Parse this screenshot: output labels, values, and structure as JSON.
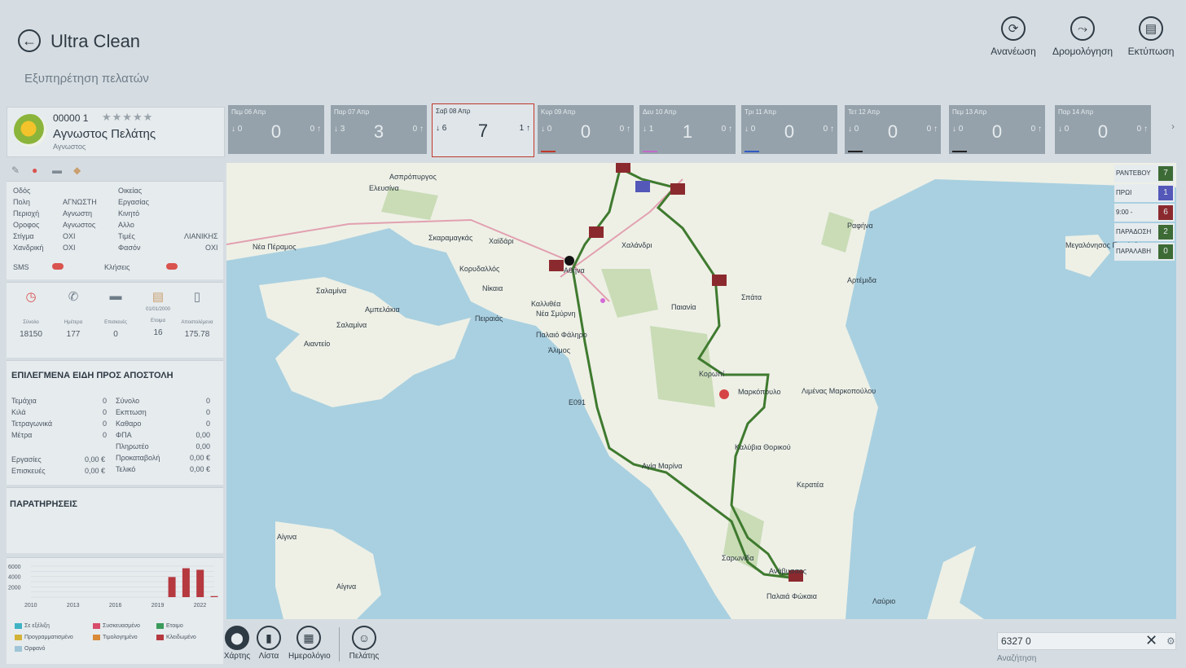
{
  "header": {
    "title": "Ultra Clean",
    "subtitle": "Εξυπηρέτηση πελατών",
    "buttons": [
      {
        "label": "Ανανέωση",
        "icon": "refresh-icon"
      },
      {
        "label": "Δρομολόγηση",
        "icon": "routing-icon"
      },
      {
        "label": "Εκτύπωση",
        "icon": "print-icon"
      }
    ]
  },
  "customer": {
    "code": "00000  1",
    "stars": "★★★★★",
    "name": "Αγνωστος Πελάτης",
    "type": "Αγνωστος"
  },
  "info": {
    "odos_label": "Οδός",
    "oikias_label": "Οικείας",
    "poli_label": "Πολη",
    "poli_value": "ΑΓΝΩΣΤΗ",
    "ergasias_label": "Εργασίας",
    "periochi_label": "Περιοχή",
    "periochi_value": "Αγνωστη",
    "kinito_label": "Κινητό",
    "orofos_label": "Οροφος",
    "orofos_value": "Αγνωστος",
    "allo_label": "Αλλο",
    "stigma_label": "Στίγμα",
    "stigma_value": "ΟΧΙ",
    "times_label": "Τιμές",
    "times_value": "ΛΙΑΝΙΚΗΣ",
    "chandriki_label": "Χανδρική",
    "chandriki_value": "ΟΧΙ",
    "fason_label": "Φασόν",
    "fason_value": "ΟΧΙ",
    "sms_label": "SMS",
    "kliseis_label": "Κλήσεις"
  },
  "stats": {
    "date": "01/01/2000",
    "items": [
      {
        "label": "Σύνολο",
        "value": "18150"
      },
      {
        "label": "Ημέτερα",
        "value": "177"
      },
      {
        "label": "Επισκευές",
        "value": "0"
      },
      {
        "label": "Ετοιμα",
        "value": "16"
      },
      {
        "label": "Αποστολέμενα",
        "value": "175.78"
      }
    ]
  },
  "selected_items": {
    "title": "ΕΠΙΛΕΓΜΕΝΑ ΕΙΔΗ ΠΡΟΣ ΑΠΟΣΤΟΛΗ",
    "left": [
      {
        "label": "Τεμάχια",
        "value": "0"
      },
      {
        "label": "Κιλά",
        "value": "0"
      },
      {
        "label": "Τετραγωνικά",
        "value": "0"
      },
      {
        "label": "Μέτρα",
        "value": "0"
      }
    ],
    "right": [
      {
        "label": "Σύνολο",
        "value": "0"
      },
      {
        "label": "Εκπτωση",
        "value": "0"
      },
      {
        "label": "Καθαρο",
        "value": "0"
      },
      {
        "label": "ΦΠΑ",
        "value": "0,00"
      },
      {
        "label": "Πληρωτέο",
        "value": "0,00"
      },
      {
        "label": "Προκαταβολή",
        "value": "0,00 €"
      },
      {
        "label": "Τελικό",
        "value": "0,00 €"
      }
    ],
    "extra": [
      {
        "label": "Εργασίες",
        "value": "0,00 €"
      },
      {
        "label": "Επισκευές",
        "value": "0,00 €"
      }
    ]
  },
  "notes": {
    "title": "ΠΑΡΑΤΗΡΗΣΕΙΣ"
  },
  "chart_data": {
    "type": "bar",
    "categories": [
      "2010",
      "2013",
      "2016",
      "2019",
      "2022"
    ],
    "yticks": [
      "6000",
      "4000",
      "2000"
    ],
    "ylim": [
      0,
      6000
    ],
    "bars": [
      {
        "x": 2020,
        "value": 3900
      },
      {
        "x": 2021,
        "value": 5600
      },
      {
        "x": 2022,
        "value": 5300
      },
      {
        "x": 2023,
        "value": 200
      }
    ],
    "bar_color": "#b5393f",
    "legend": [
      {
        "label": "Σε εξέλιξη",
        "color": "#3fb3c4"
      },
      {
        "label": "Συσκευασμένο",
        "color": "#d84d6a"
      },
      {
        "label": "Ετοιμο",
        "color": "#3a9b5b"
      },
      {
        "label": "Προγραμματισμένο",
        "color": "#d2b33a"
      },
      {
        "label": "Τιμολογημένο",
        "color": "#d98a3a"
      },
      {
        "label": "Κλειδωμένο",
        "color": "#b5393f"
      },
      {
        "label": "Ορφανό",
        "color": "#9fc5d6"
      }
    ]
  },
  "days": [
    {
      "date": "Πεμ 06 Απρ",
      "big": "0",
      "left": "0",
      "right": "0",
      "ul": ""
    },
    {
      "date": "Παρ 07 Απρ",
      "big": "3",
      "left": "3",
      "right": "0",
      "ul": ""
    },
    {
      "date": "Σαβ 08 Απρ",
      "big": "7",
      "left": "6",
      "right": "1",
      "ul": ""
    },
    {
      "date": "Κυρ 09 Απρ",
      "big": "0",
      "left": "0",
      "right": "0",
      "ul": "#c0392b"
    },
    {
      "date": "Δευ 10 Απρ",
      "big": "1",
      "left": "1",
      "right": "0",
      "ul": "#c06ac8"
    },
    {
      "date": "Τρι 11 Απρ",
      "big": "0",
      "left": "0",
      "right": "0",
      "ul": "#2e5bc4"
    },
    {
      "date": "Τετ 12 Απρ",
      "big": "0",
      "left": "0",
      "right": "0",
      "ul": "#222222"
    },
    {
      "date": "Πεμ 13 Απρ",
      "big": "0",
      "left": "0",
      "right": "0",
      "ul": "#222222"
    },
    {
      "date": "Παρ 14 Απρ",
      "big": "0",
      "left": "0",
      "right": "0",
      "ul": ""
    }
  ],
  "map": {
    "labels": [
      "Ασπρόπυργος",
      "Ελευσίνα",
      "Νέα Πέραμος",
      "Σκαραμαγκάς",
      "Χαϊδάρι",
      "Κορυδαλλός",
      "Νίκαια",
      "Σαλαμίνα",
      "Αμπελάκια",
      "Σαλαμίνα",
      "Αιαντείο",
      "Πειραιάς",
      "Καλλιθέα",
      "Νέα Σμύρνη",
      "Παλαιό Φάληρο",
      "Άλιμος",
      "Αθήνα",
      "Χαλάνδρι",
      "Παιανία",
      "Σπάτα",
      "Ραφήνα",
      "Αρτέμιδα",
      "Κορωπί",
      "Μαρκόπουλο",
      "Λιμένας Μαρκοπούλου",
      "Καλύβια Θορικού",
      "Αγία Μαρίνα",
      "Κερατέα",
      "Σαρωνίδα",
      "Ανάβυσσος",
      "Παλαιά Φώκαια",
      "Λαύριο",
      "Αίγινα",
      "Αίγινα",
      "Μεγαλόνησος Πεταλιών",
      "Ε091"
    ],
    "legend": [
      {
        "label": "ΡΑΝΤΕΒΟΥ",
        "value": "7",
        "color": "#3d6b35"
      },
      {
        "label": "ΠΡΩΙ",
        "value": "1",
        "color": "#5458b8"
      },
      {
        "label": "9:00 -",
        "value": "6",
        "color": "#8b2a2e"
      },
      {
        "label": "ΠΑΡΑΔΟΣΗ",
        "value": "2",
        "color": "#3d6b35"
      },
      {
        "label": "ΠΑΡΑΛΑΒΗ",
        "value": "0",
        "color": "#3d6b35"
      }
    ]
  },
  "bottom": {
    "buttons": [
      {
        "label": "Χάρτης",
        "icon": "map-pin-icon"
      },
      {
        "label": "Λίστα",
        "icon": "bar-list-icon"
      },
      {
        "label": "Ημερολόγιο",
        "icon": "calendar-icon"
      },
      {
        "label": "Πελάτης",
        "icon": "person-icon"
      }
    ],
    "search_value": "6327 0",
    "search_label": "Αναζήτηση"
  }
}
